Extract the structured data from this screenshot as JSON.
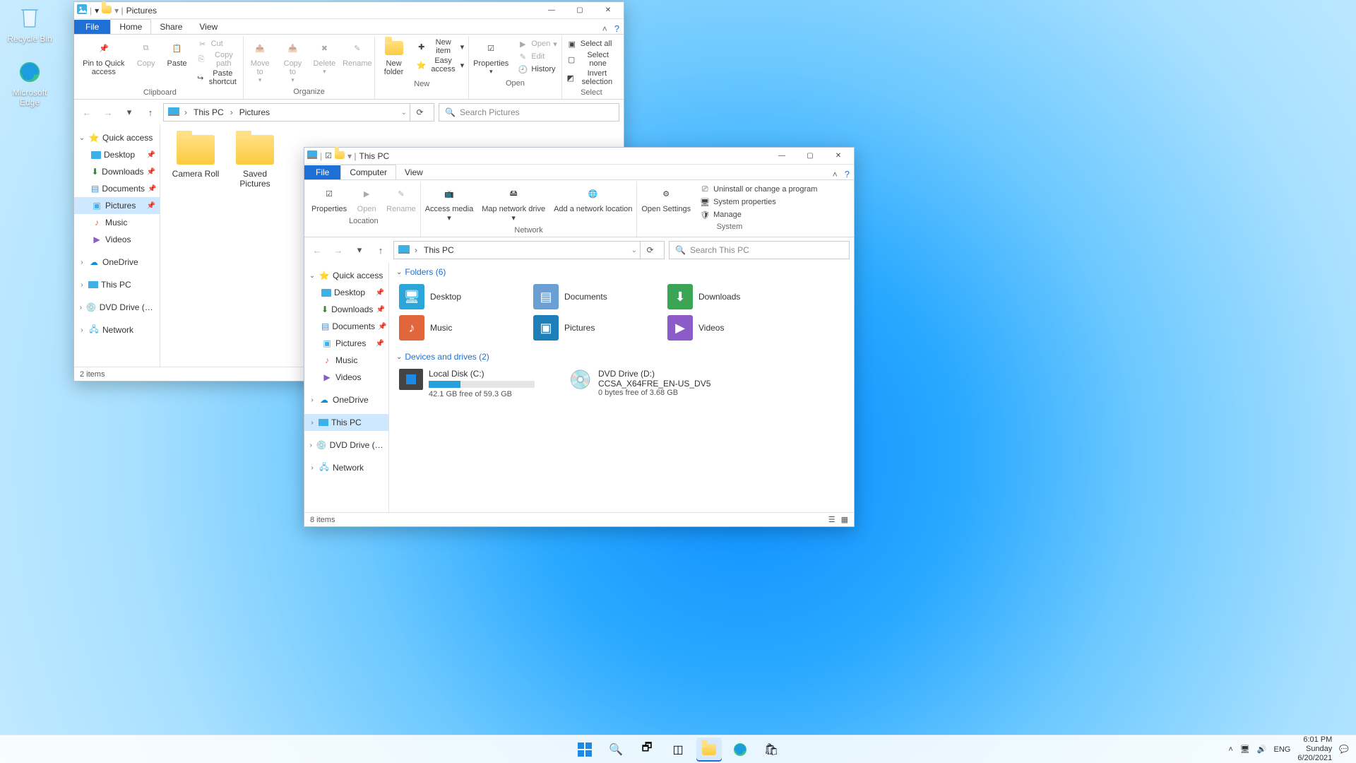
{
  "desktop": {
    "recycle_bin": "Recycle Bin",
    "edge": "Microsoft Edge"
  },
  "win1": {
    "title": "Pictures",
    "tabs": {
      "file": "File",
      "home": "Home",
      "share": "Share",
      "view": "View"
    },
    "ribbon": {
      "pin": "Pin to Quick access",
      "copy": "Copy",
      "paste": "Paste",
      "cut": "Cut",
      "copypath": "Copy path",
      "pasteshortcut": "Paste shortcut",
      "clipboard_lbl": "Clipboard",
      "moveto": "Move to",
      "copyto": "Copy to",
      "delete": "Delete",
      "rename": "Rename",
      "organize_lbl": "Organize",
      "newfolder": "New folder",
      "newitem": "New item",
      "easyaccess": "Easy access",
      "new_lbl": "New",
      "properties": "Properties",
      "open": "Open",
      "edit": "Edit",
      "history": "History",
      "open_lbl": "Open",
      "selectall": "Select all",
      "selectnone": "Select none",
      "invert": "Invert selection",
      "select_lbl": "Select"
    },
    "addr": {
      "pc": "This PC",
      "pictures": "Pictures"
    },
    "search_ph": "Search Pictures",
    "nav": {
      "quick": "Quick access",
      "desktop": "Desktop",
      "downloads": "Downloads",
      "documents": "Documents",
      "pictures": "Pictures",
      "music": "Music",
      "videos": "Videos",
      "onedrive": "OneDrive",
      "thispc": "This PC",
      "dvd": "DVD Drive (D:) CCSA",
      "network": "Network"
    },
    "items": {
      "camera": "Camera Roll",
      "saved": "Saved Pictures"
    },
    "status": "2 items"
  },
  "win2": {
    "title": "This PC",
    "tabs": {
      "file": "File",
      "computer": "Computer",
      "view": "View"
    },
    "ribbon": {
      "properties": "Properties",
      "open": "Open",
      "rename": "Rename",
      "location_lbl": "Location",
      "access": "Access media",
      "map": "Map network drive",
      "add": "Add a network location",
      "network_lbl": "Network",
      "settings": "Open Settings",
      "uninstall": "Uninstall or change a program",
      "sysprops": "System properties",
      "manage": "Manage",
      "system_lbl": "System"
    },
    "addr": {
      "pc": "This PC"
    },
    "search_ph": "Search This PC",
    "nav": {
      "quick": "Quick access",
      "desktop": "Desktop",
      "downloads": "Downloads",
      "documents": "Documents",
      "pictures": "Pictures",
      "music": "Music",
      "videos": "Videos",
      "onedrive": "OneDrive",
      "thispc": "This PC",
      "dvd": "DVD Drive (D:) CCSA",
      "network": "Network"
    },
    "sections": {
      "folders": "Folders (6)",
      "drives": "Devices and drives (2)"
    },
    "folders": {
      "desktop": "Desktop",
      "documents": "Documents",
      "downloads": "Downloads",
      "music": "Music",
      "pictures": "Pictures",
      "videos": "Videos"
    },
    "drives": {
      "c_name": "Local Disk (C:)",
      "c_free": "42.1 GB free of 59.3 GB",
      "d_name": "DVD Drive (D:)",
      "d_sub": "CCSA_X64FRE_EN-US_DV5",
      "d_free": "0 bytes free of 3.68 GB"
    },
    "status": "8 items"
  },
  "taskbar": {
    "lang": "ENG",
    "time": "6:01 PM",
    "day": "Sunday",
    "date": "6/20/2021"
  }
}
